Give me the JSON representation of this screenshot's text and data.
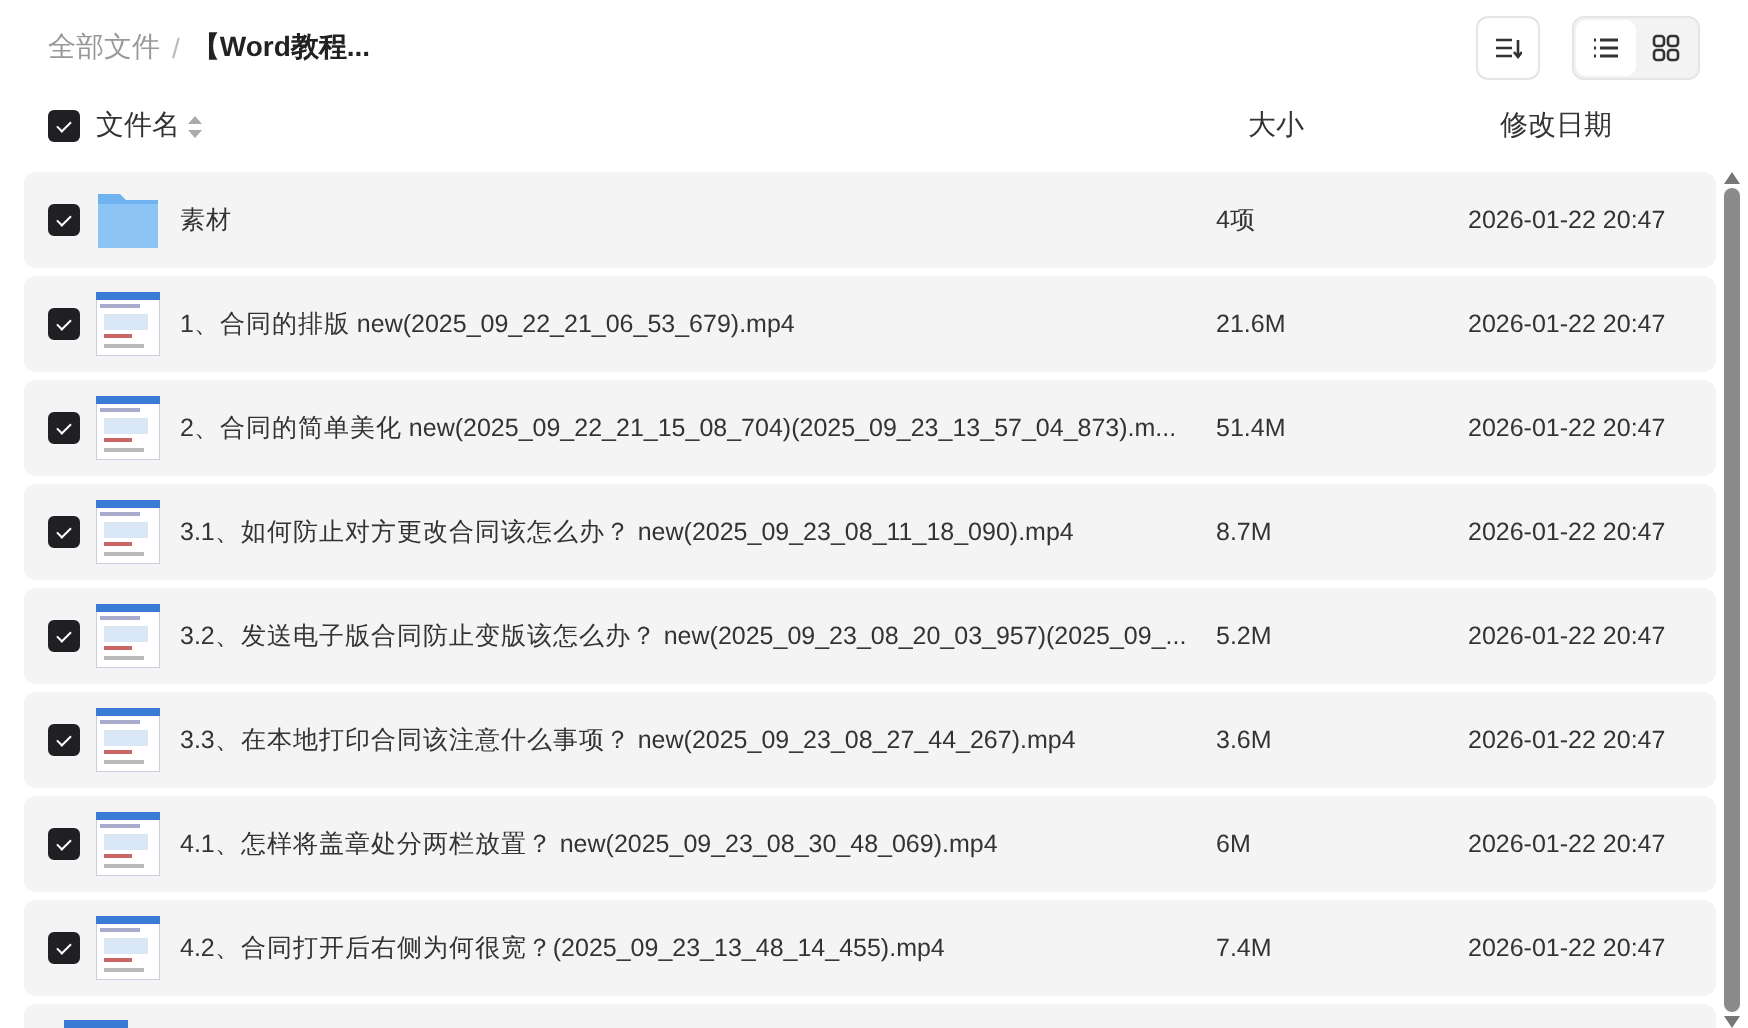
{
  "breadcrumb": [
    {
      "label": "全部文件"
    },
    {
      "label": "【Word教程..."
    }
  ],
  "breadcrumb_separator": "/",
  "view_modes": [
    {
      "kind": "list",
      "selected": true
    },
    {
      "kind": "grid",
      "selected": false
    }
  ],
  "columns": {
    "select_all": true,
    "name": "文件名",
    "size": "大小",
    "modified": "修改日期"
  },
  "rows": [
    {
      "kind": "folder",
      "checked": true,
      "name": "素材",
      "size": "4项",
      "modified": "2026-01-22 20:47"
    },
    {
      "kind": "video",
      "checked": true,
      "name": "1、合同的排版 new(2025_09_22_21_06_53_679).mp4",
      "size": "21.6M",
      "modified": "2026-01-22 20:47"
    },
    {
      "kind": "video",
      "checked": true,
      "name": "2、合同的简单美化 new(2025_09_22_21_15_08_704)(2025_09_23_13_57_04_873).m...",
      "size": "51.4M",
      "modified": "2026-01-22 20:47"
    },
    {
      "kind": "video",
      "checked": true,
      "name": "3.1、如何防止对方更改合同该怎么办？  new(2025_09_23_08_11_18_090).mp4",
      "size": "8.7M",
      "modified": "2026-01-22 20:47"
    },
    {
      "kind": "video",
      "checked": true,
      "name": "3.2、发送电子版合同防止变版该怎么办？  new(2025_09_23_08_20_03_957)(2025_09_...",
      "size": "5.2M",
      "modified": "2026-01-22 20:47"
    },
    {
      "kind": "video",
      "checked": true,
      "name": "3.3、在本地打印合同该注意什么事项？  new(2025_09_23_08_27_44_267).mp4",
      "size": "3.6M",
      "modified": "2026-01-22 20:47"
    },
    {
      "kind": "video",
      "checked": true,
      "name": "4.1、怎样将盖章处分两栏放置？  new(2025_09_23_08_30_48_069).mp4",
      "size": "6M",
      "modified": "2026-01-22 20:47"
    },
    {
      "kind": "video",
      "checked": true,
      "name": "4.2、合同打开后右侧为何很宽？(2025_09_23_13_48_14_455).mp4",
      "size": "7.4M",
      "modified": "2026-01-22 20:47"
    },
    {
      "kind": "video"
    }
  ]
}
